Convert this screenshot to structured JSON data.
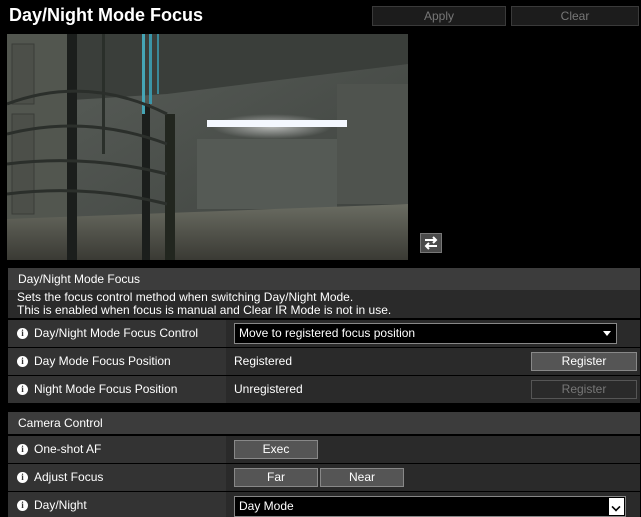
{
  "header": {
    "title": "Day/Night Mode Focus",
    "apply_label": "Apply",
    "clear_label": "Clear"
  },
  "focus_section": {
    "title": "Day/Night Mode Focus",
    "description_line1": "Sets the focus control method when switching Day/Night Mode.",
    "description_line2": "This is enabled when focus is manual and Clear IR Mode is not in use.",
    "rows": [
      {
        "label": "Day/Night Mode Focus Control",
        "value": "Move to registered focus position"
      },
      {
        "label": "Day Mode Focus Position",
        "value": "Registered",
        "button": "Register"
      },
      {
        "label": "Night Mode Focus Position",
        "value": "Unregistered",
        "button": "Register"
      }
    ]
  },
  "camera_section": {
    "title": "Camera Control",
    "rows": [
      {
        "label": "One-shot AF",
        "button": "Exec"
      },
      {
        "label": "Adjust Focus",
        "far": "Far",
        "near": "Near"
      },
      {
        "label": "Day/Night",
        "value": "Day Mode"
      }
    ]
  },
  "icons": {
    "info": "info-icon",
    "swap": "swap-arrows-icon"
  }
}
